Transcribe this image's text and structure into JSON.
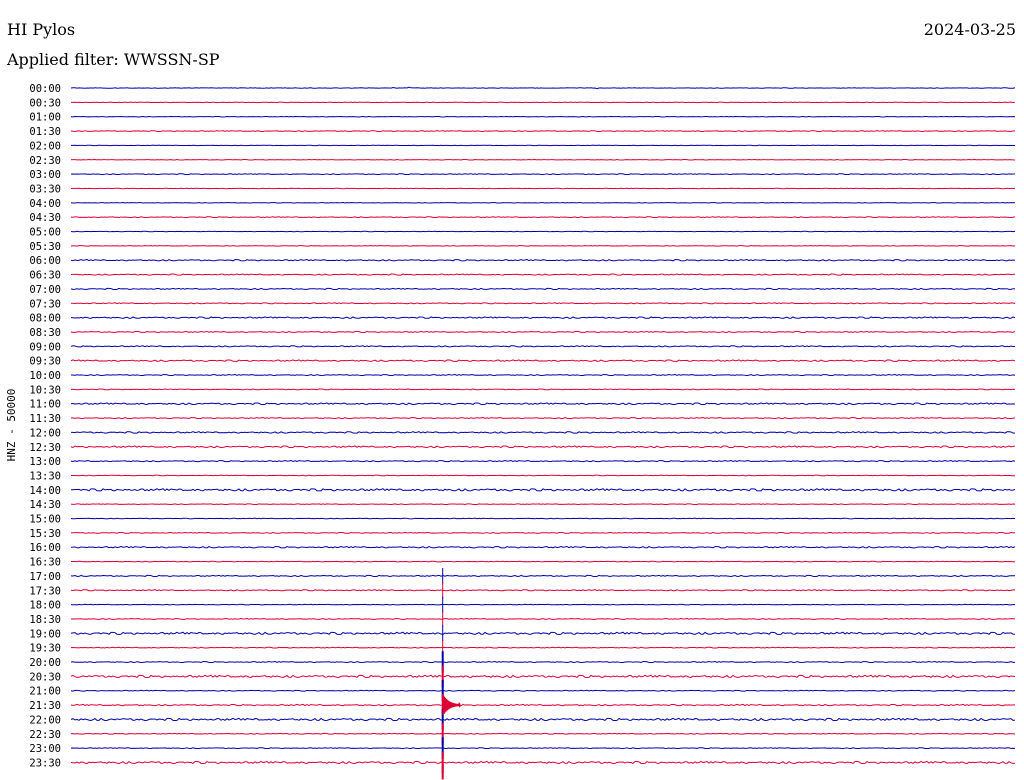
{
  "header": {
    "station": "HI Pylos",
    "date": "2024-03-25",
    "filter_label": "Applied filter: WWSSN-SP"
  },
  "chart_data": {
    "type": "line",
    "chart_kind": "helicorder",
    "ylabel": "HNZ - 50000",
    "row_labels": [
      "00:00",
      "00:30",
      "01:00",
      "01:30",
      "02:00",
      "02:30",
      "03:00",
      "03:30",
      "04:00",
      "04:30",
      "05:00",
      "05:30",
      "06:00",
      "06:30",
      "07:00",
      "07:30",
      "08:00",
      "08:30",
      "09:00",
      "09:30",
      "10:00",
      "10:30",
      "11:00",
      "11:30",
      "12:00",
      "12:30",
      "13:00",
      "13:30",
      "14:00",
      "14:30",
      "15:00",
      "15:30",
      "16:00",
      "16:30",
      "17:00",
      "17:30",
      "18:00",
      "18:30",
      "19:00",
      "19:30",
      "20:00",
      "20:30",
      "21:00",
      "21:30",
      "22:00",
      "22:30",
      "23:00",
      "23:30"
    ],
    "trace_colors": [
      "#0000aa",
      "#dd0033"
    ],
    "row_noise": [
      0.3,
      0.3,
      0.3,
      0.5,
      0.3,
      0.3,
      0.5,
      0.3,
      0.3,
      0.5,
      0.3,
      0.3,
      0.8,
      0.7,
      0.7,
      0.6,
      0.9,
      0.6,
      0.7,
      0.9,
      0.6,
      0.5,
      1.0,
      0.6,
      0.9,
      1.0,
      0.7,
      0.4,
      1.4,
      0.4,
      0.4,
      0.5,
      0.9,
      0.4,
      0.7,
      0.7,
      0.4,
      0.5,
      1.3,
      0.5,
      0.6,
      1.4,
      0.5,
      0.8,
      1.4,
      0.5,
      0.5,
      1.3
    ],
    "event": {
      "start_row_label": "17:00",
      "end_row_label": "23:30",
      "minute_into_window": 11.8,
      "peak_row_label": "21:30",
      "grid": false
    }
  }
}
